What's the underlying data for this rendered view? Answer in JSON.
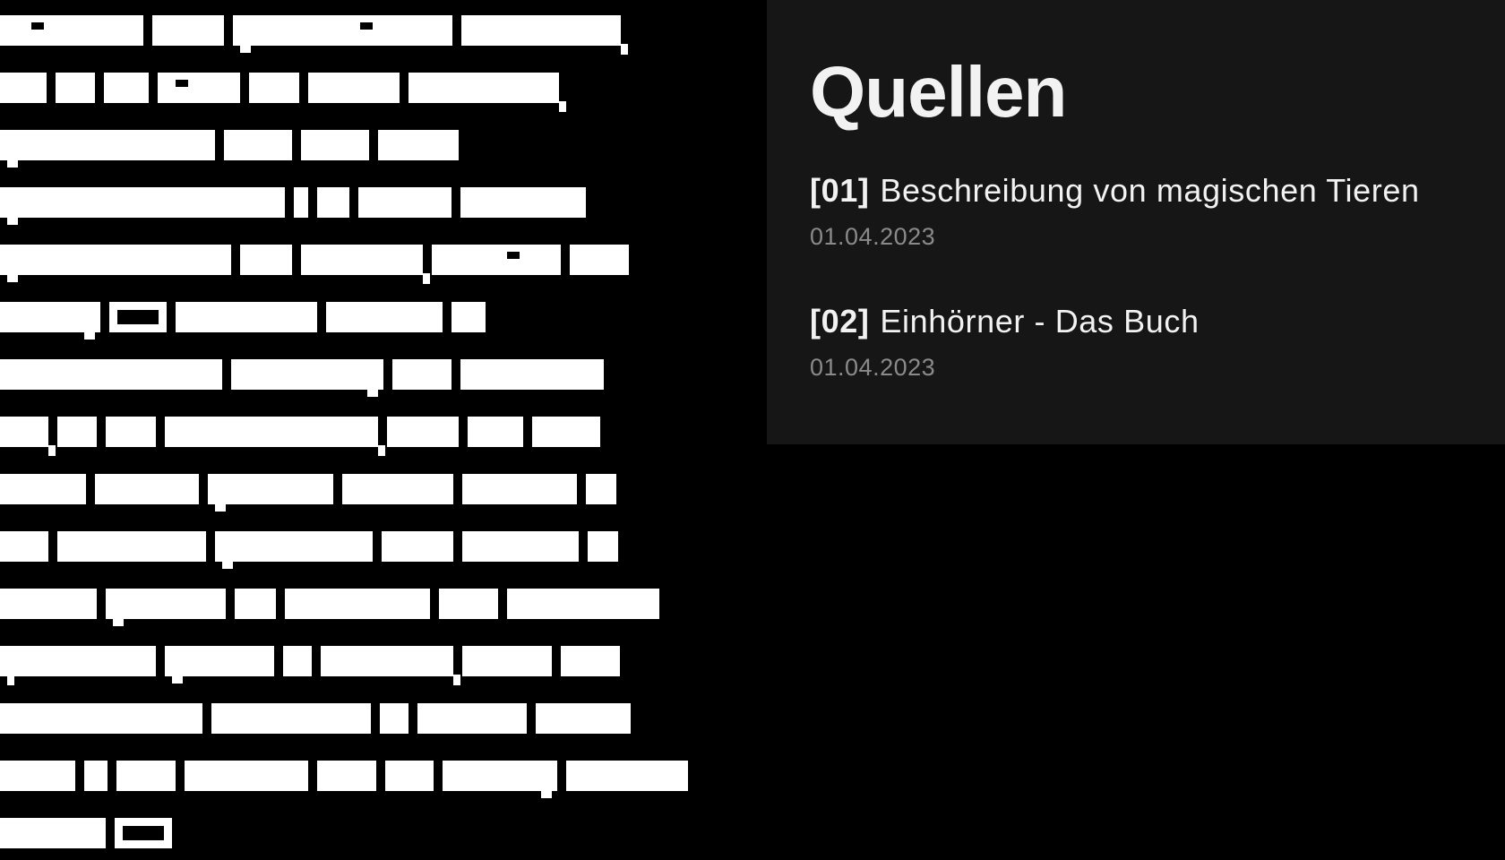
{
  "sources_panel": {
    "heading": "Quellen",
    "items": [
      {
        "index": "[01]",
        "title": "Beschreibung von magischen Tieren",
        "date": "01.04.2023"
      },
      {
        "index": "[02]",
        "title": "Einhörner - Das Buch",
        "date": "01.04.2023"
      }
    ]
  },
  "colors": {
    "background": "#000000",
    "panel_background": "#161616",
    "primary_text": "#f2f2f2",
    "secondary_text": "#8a8a8a",
    "redacted_text": "#ffffff"
  }
}
